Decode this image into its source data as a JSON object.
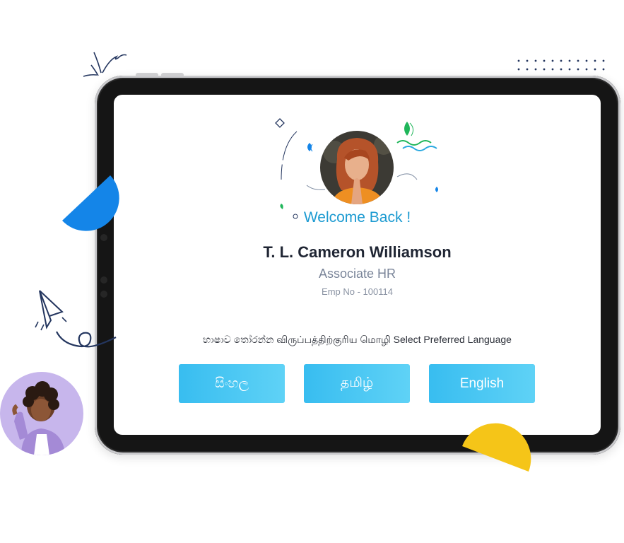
{
  "welcome": {
    "greeting": "Welcome Back !",
    "name": "T. L. Cameron Williamson",
    "role": "Associate HR",
    "emp_no": "Emp No - 100114"
  },
  "language": {
    "prompt": "භාෂාව තෝරන්න விருப்பத்திற்குரிய மொழி Select Preferred Language",
    "options": [
      {
        "label": "සිංහල"
      },
      {
        "label": "தமிழ்"
      },
      {
        "label": "English"
      }
    ]
  },
  "colors": {
    "accent": "#1b9ad1",
    "button": "#45c6f3",
    "blue_shape": "#1485e8",
    "yellow_shape": "#f5c518",
    "dark_navy": "#24365f"
  },
  "icons": {
    "paper_plane": "paper-plane-icon",
    "sparkle": "sparkle-doodle-icon"
  }
}
